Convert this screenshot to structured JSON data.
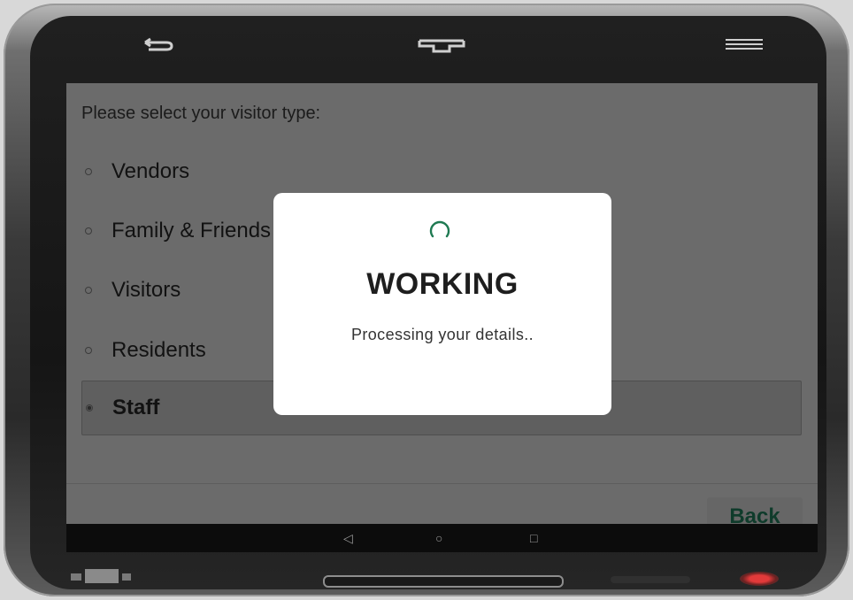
{
  "device": {
    "hw_buttons": [
      "back-arrow-icon",
      "home-icon",
      "menu-icon"
    ]
  },
  "screen": {
    "prompt": "Please select your visitor type:",
    "options": [
      {
        "label": "Vendors",
        "selected": false
      },
      {
        "label": "Family & Friends",
        "selected": false
      },
      {
        "label": "Visitors",
        "selected": false
      },
      {
        "label": "Residents",
        "selected": false
      },
      {
        "label": "Staff",
        "selected": true
      }
    ],
    "back_label": "Back"
  },
  "dialog": {
    "title": "WORKING",
    "message": "Processing your details..",
    "spinner_color": "#1f7a52"
  },
  "navbar": {
    "icons": [
      "nav-back-icon",
      "nav-home-icon",
      "nav-recents-icon"
    ]
  }
}
